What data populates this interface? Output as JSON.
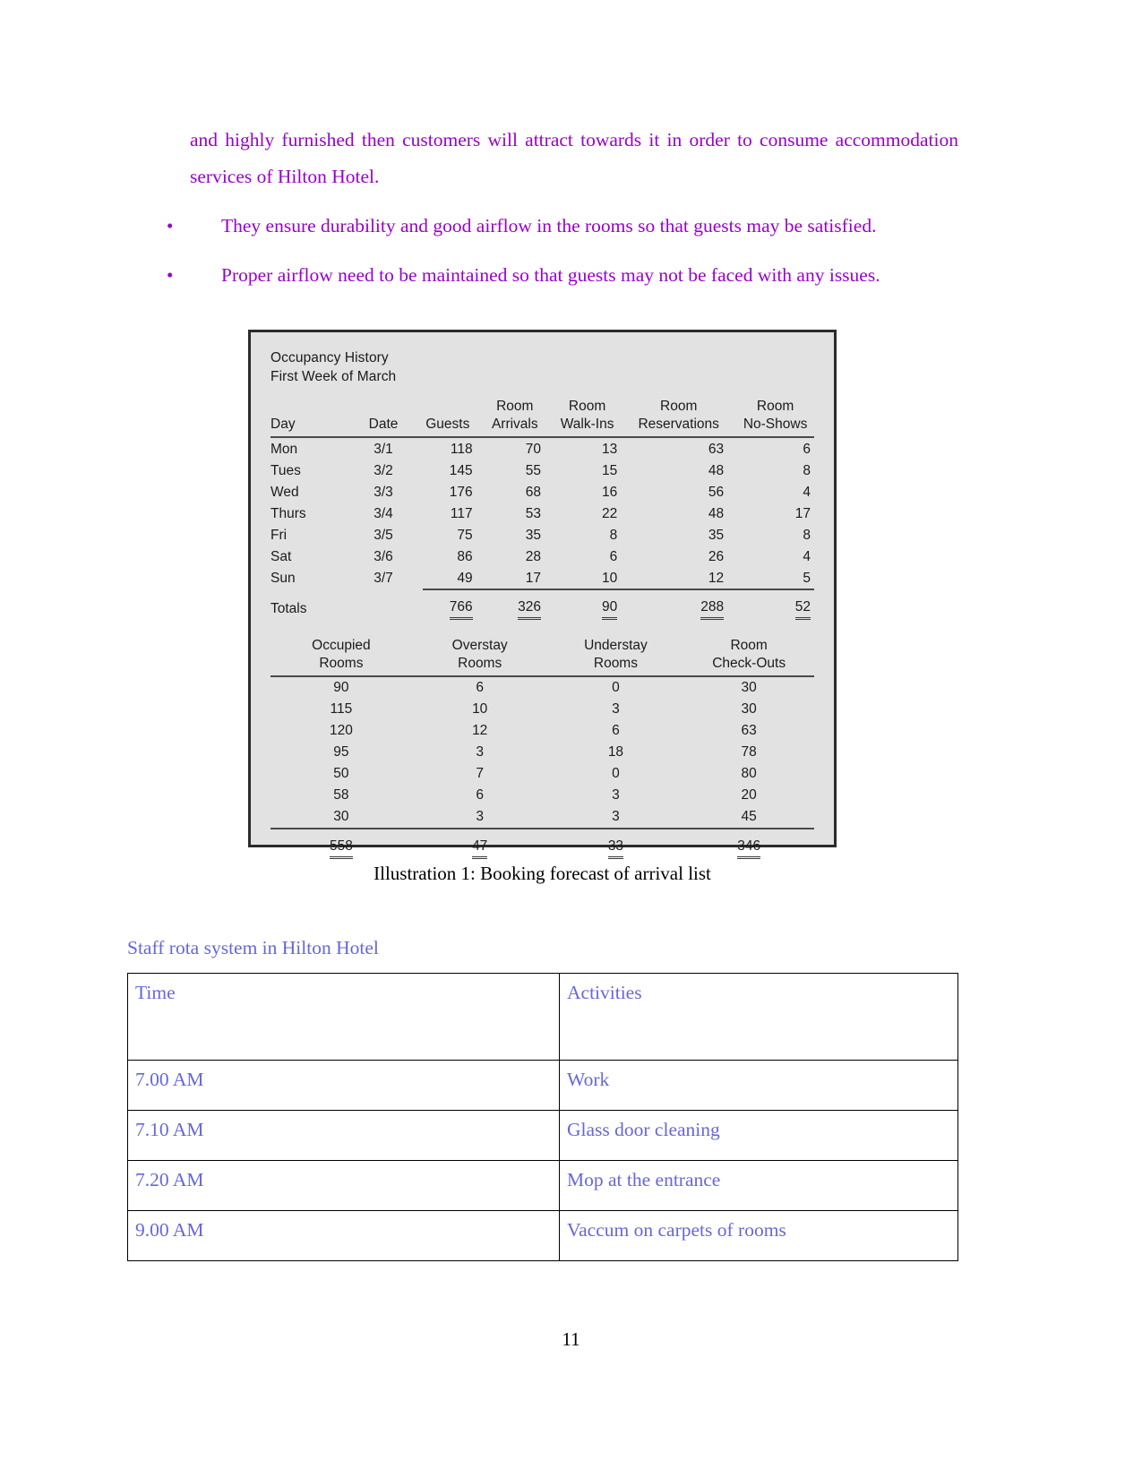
{
  "body": {
    "paragraph": "and highly furnished then customers will attract towards it in order to consume accommodation services of Hilton Hotel.",
    "bullets": [
      "They ensure durability and good airflow in the rooms so that guests may be satisfied.",
      "Proper airflow need to be maintained so that guests may not be faced with any issues."
    ],
    "bullet_glyph": "•"
  },
  "figure": {
    "caption": "Illustration 1: Booking forecast of arrival list",
    "title_line1": "Occupancy History",
    "title_line2": "First Week of March",
    "totals_label": "Totals"
  },
  "chart_data": {
    "type": "table",
    "title": "Occupancy History — First Week of March",
    "tables": [
      {
        "name": "occupancy-upper",
        "columns": [
          "Day",
          "Date",
          "Guests",
          "Room\nArrivals",
          "Room\nWalk-Ins",
          "Room\nReservations",
          "Room\nNo-Shows"
        ],
        "rows": [
          [
            "Mon",
            "3/1",
            "118",
            "70",
            "13",
            "63",
            "6"
          ],
          [
            "Tues",
            "3/2",
            "145",
            "55",
            "15",
            "48",
            "8"
          ],
          [
            "Wed",
            "3/3",
            "176",
            "68",
            "16",
            "56",
            "4"
          ],
          [
            "Thurs",
            "3/4",
            "117",
            "53",
            "22",
            "48",
            "17"
          ],
          [
            "Fri",
            "3/5",
            "75",
            "35",
            "8",
            "35",
            "8"
          ],
          [
            "Sat",
            "3/6",
            "86",
            "28",
            "6",
            "26",
            "4"
          ],
          [
            "Sun",
            "3/7",
            "49",
            "17",
            "10",
            "12",
            "5"
          ]
        ],
        "totals": [
          "Totals",
          "",
          "766",
          "326",
          "90",
          "288",
          "52"
        ]
      },
      {
        "name": "occupancy-lower",
        "columns": [
          "Occupied\nRooms",
          "Overstay\nRooms",
          "Understay\nRooms",
          "Room\nCheck-Outs"
        ],
        "rows": [
          [
            "90",
            "6",
            "0",
            "30"
          ],
          [
            "115",
            "10",
            "3",
            "30"
          ],
          [
            "120",
            "12",
            "6",
            "63"
          ],
          [
            "95",
            "3",
            "18",
            "78"
          ],
          [
            "50",
            "7",
            "0",
            "80"
          ],
          [
            "58",
            "6",
            "3",
            "20"
          ],
          [
            "30",
            "3",
            "3",
            "45"
          ]
        ],
        "totals": [
          "558",
          "47",
          "33",
          "346"
        ]
      }
    ]
  },
  "rota": {
    "heading": "Staff rota system in Hilton Hotel",
    "columns": [
      "Time",
      "Activities"
    ],
    "rows": [
      {
        "time": "7.00 AM",
        "activity": "Work"
      },
      {
        "time": "7.10 AM",
        "activity": "Glass door cleaning"
      },
      {
        "time": "7.20 AM",
        "activity": "Mop at the entrance"
      },
      {
        "time": "9.00 AM",
        "activity": "Vaccum on carpets of rooms"
      }
    ]
  },
  "footer": {
    "page_number": "11"
  },
  "colors": {
    "body_text": "#9900cc",
    "rota_text": "#6666dd",
    "caption_text": "#000000",
    "figure_bg": "#e2e2e2"
  }
}
